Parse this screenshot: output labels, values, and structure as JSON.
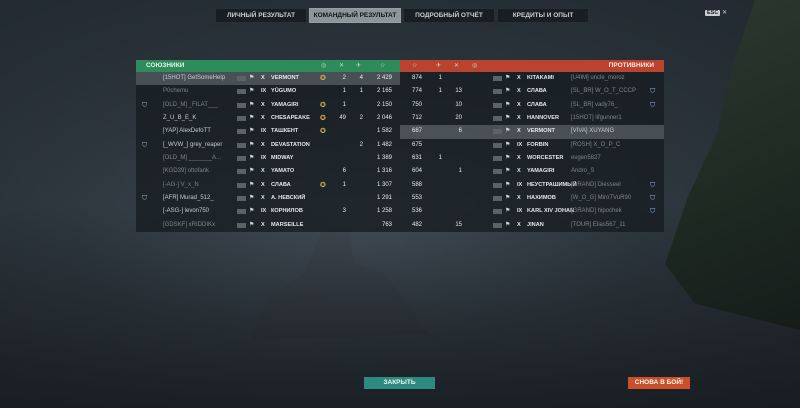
{
  "tabs": [
    {
      "label": "ЛИЧНЫЙ РЕЗУЛЬТАТ"
    },
    {
      "label": "КОМАНДНЫЙ РЕЗУЛЬТАТ"
    },
    {
      "label": "ПОДРОБНЫЙ ОТЧЁТ"
    },
    {
      "label": "КРЕДИТЫ И ОПЫТ"
    }
  ],
  "esc": {
    "key": "ESC",
    "icon": "close-icon"
  },
  "allies": {
    "title": "СОЮЗНИКИ",
    "rows": [
      {
        "player": "[15HOT] GetSomeHelp",
        "tier": "X",
        "ship": "VERMONT",
        "medal": true,
        "kills": "2",
        "planes": "4",
        "xp": "2 429",
        "sel": true
      },
      {
        "player": "P0chemu",
        "tier": "IX",
        "ship": "YŪGUMO",
        "medal": false,
        "kills": "1",
        "planes": "1",
        "xp": "2 165",
        "dim": true
      },
      {
        "player": "[OLD_M] _FILAT___",
        "tier": "X",
        "ship": "YAMAGIRI",
        "medal": true,
        "kills": "1",
        "planes": "",
        "xp": "2 150",
        "clan": true,
        "dim": true
      },
      {
        "player": "Z_U_B_E_K",
        "tier": "X",
        "ship": "CHESAPEAKE",
        "medal": true,
        "kills": "49",
        "planes": "2",
        "xp": "2 046"
      },
      {
        "player": "[YAP] AlexDefoTT",
        "tier": "IX",
        "ship": "ТАШКЕНТ",
        "medal": true,
        "kills": "",
        "planes": "",
        "xp": "1 582"
      },
      {
        "player": "[_WVW_] grey_reaper",
        "tier": "X",
        "ship": "DEVASTATION",
        "medal": false,
        "kills": "",
        "planes": "2",
        "xp": "1 482",
        "clan": true
      },
      {
        "player": "[OLD_M] _______A...",
        "tier": "IX",
        "ship": "MIDWAY",
        "medal": false,
        "kills": "",
        "planes": "",
        "xp": "1 389",
        "dim": true
      },
      {
        "player": "[KGD39] ottofank",
        "tier": "X",
        "ship": "YAMATO",
        "medal": false,
        "kills": "6",
        "planes": "",
        "xp": "1 316",
        "dim": true
      },
      {
        "player": "[-AG-] V_x_N",
        "tier": "X",
        "ship": "СЛАВА",
        "medal": true,
        "kills": "1",
        "planes": "",
        "xp": "1 307",
        "dim": true
      },
      {
        "player": "[AFR] Murad_512_",
        "tier": "X",
        "ship": "A. НЕВСКИЙ",
        "medal": false,
        "kills": "",
        "planes": "",
        "xp": "1 291",
        "clan": true
      },
      {
        "player": "[-ASG-] levon750",
        "tier": "IX",
        "ship": "КОРНИЛОВ",
        "medal": false,
        "kills": "3",
        "planes": "",
        "xp": "1 258"
      },
      {
        "player": "[GDSKF] xRIDDIKx",
        "tier": "X",
        "ship": "MARSEILLE",
        "medal": false,
        "kills": "",
        "planes": "",
        "xp": "763",
        "dim": true
      }
    ]
  },
  "enemies": {
    "title": "ПРОТИВНИКИ",
    "rows": [
      {
        "xp": "874",
        "kills": "1",
        "planes": "",
        "tier": "X",
        "ship": "KITAKAMI",
        "player": "[U4IM] uncle_moroz",
        "dim": true
      },
      {
        "xp": "774",
        "kills": "1",
        "planes": "13",
        "tier": "X",
        "ship": "СЛАВА",
        "player": "[SL_BR] W_O_T_СССР",
        "dim": true,
        "clan": true
      },
      {
        "xp": "750",
        "kills": "",
        "planes": "10",
        "tier": "X",
        "ship": "СЛАВА",
        "player": "[SL_BR] vady76_",
        "dim": true,
        "clan": true
      },
      {
        "xp": "712",
        "kills": "",
        "planes": "20",
        "tier": "X",
        "ship": "HANNOVER",
        "player": "[15HOT] lifgunner1",
        "dim": true
      },
      {
        "xp": "687",
        "kills": "",
        "planes": "6",
        "tier": "X",
        "ship": "VERMONT",
        "player": "[VIVA] XUYANG",
        "sel": true
      },
      {
        "xp": "675",
        "kills": "",
        "planes": "",
        "tier": "IX",
        "ship": "FORBIN",
        "player": "[ROSH] X_O_P_C",
        "dim": true
      },
      {
        "xp": "631",
        "kills": "1",
        "planes": "",
        "tier": "X",
        "ship": "WORCESTER",
        "player": "evgen5827",
        "dim": true
      },
      {
        "xp": "604",
        "kills": "",
        "planes": "1",
        "tier": "X",
        "ship": "YAMAGIRI",
        "player": "Andro_S",
        "dim": true
      },
      {
        "xp": "588",
        "kills": "",
        "planes": "",
        "tier": "IX",
        "ship": "НЕУСТРАШИМЫЙ",
        "player": "[GRAND] Diesseel",
        "dim": true,
        "clan": true
      },
      {
        "xp": "553",
        "kills": "",
        "planes": "",
        "tier": "X",
        "ship": "НАХИМОВ",
        "player": "[W_O_G] MiroTVuR90",
        "dim": true,
        "clan": true
      },
      {
        "xp": "536",
        "kills": "",
        "planes": "",
        "tier": "IX",
        "ship": "KARL XIV JOHAN",
        "player": "[GRAND] hipochek",
        "dim": true,
        "clan": true
      },
      {
        "xp": "482",
        "kills": "",
        "planes": "15",
        "tier": "X",
        "ship": "JINAN",
        "player": "[TOUR] Elias567_11",
        "dim": true
      }
    ]
  },
  "buttons": {
    "close": "ЗАКРЫТЬ",
    "again": "СНОВА В БОЙ!"
  }
}
